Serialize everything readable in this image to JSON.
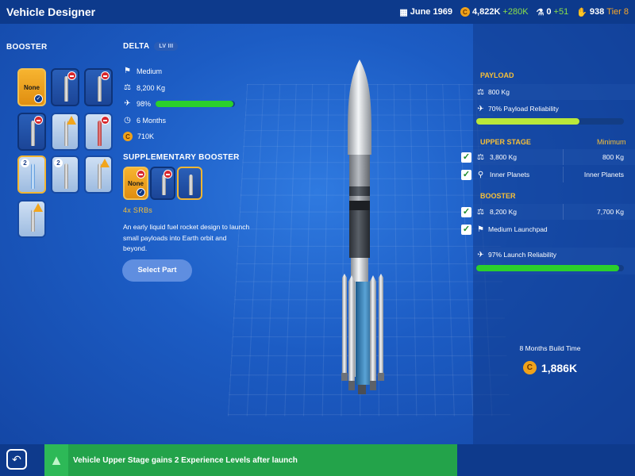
{
  "app": {
    "title": "Vehicle Designer"
  },
  "header": {
    "date": "June 1969",
    "funds": "4,822K",
    "funds_delta": "+280K",
    "science": "0",
    "science_delta": "+51",
    "reputation": "938",
    "tier": "Tier 8"
  },
  "booster_panel": {
    "title": "BOOSTER",
    "tiles": [
      {
        "label": "None",
        "state": "selected-none"
      },
      {
        "label": "",
        "state": "locked"
      },
      {
        "label": "",
        "state": "locked"
      },
      {
        "label": "",
        "state": "locked"
      },
      {
        "label": "",
        "state": "warning"
      },
      {
        "label": "",
        "state": "locked"
      },
      {
        "label": "2",
        "state": "selected"
      },
      {
        "label": "2",
        "state": "available"
      },
      {
        "label": "",
        "state": "warning"
      },
      {
        "label": "",
        "state": "warning"
      }
    ]
  },
  "vehicle": {
    "name": "DELTA",
    "level": "LV III",
    "pad": "Medium",
    "mass": "8,200 Kg",
    "reliability": "98%",
    "reliability_pct": 98,
    "build_time": "6 Months",
    "cost": "710K"
  },
  "supplementary": {
    "title": "SUPPLEMENTARY BOOSTER",
    "tiles": [
      {
        "label": "None",
        "state": "none-checked"
      },
      {
        "label": "",
        "state": "locked"
      },
      {
        "label": "",
        "state": "selected"
      }
    ],
    "selected_label": "4x SRBs",
    "description": "An early liquid fuel rocket design to launch small payloads into Earth orbit and beyond.",
    "select_button": "Select Part"
  },
  "right_panel": {
    "payload_title": "PAYLOAD",
    "payload_mass": "800 Kg",
    "payload_reliability": "70% Payload Reliability",
    "payload_reliability_pct": 70,
    "upper_stage_title": "UPPER STAGE",
    "minimum_label": "Minimum",
    "upper_rows": [
      {
        "left": "3,800 Kg",
        "right": "800 Kg"
      },
      {
        "left": "Inner Planets",
        "right": "Inner Planets"
      }
    ],
    "booster_title": "BOOSTER",
    "booster_rows": [
      {
        "left": "8,200 Kg",
        "right": "7,700 Kg"
      },
      {
        "left": "Medium Launchpad",
        "right": ""
      }
    ],
    "launch_reliability": "97% Launch Reliability",
    "launch_reliability_pct": 97,
    "build_time": "8 Months Build Time",
    "build_cost": "1,886K"
  },
  "footer": {
    "notice": "Vehicle Upper Stage gains 2 Experience Levels after launch"
  },
  "colors": {
    "accent_gold": "#f7c038",
    "bar_green": "#2bd02b",
    "bar_lime": "#b9e83a",
    "notice_green": "#23a34a"
  }
}
